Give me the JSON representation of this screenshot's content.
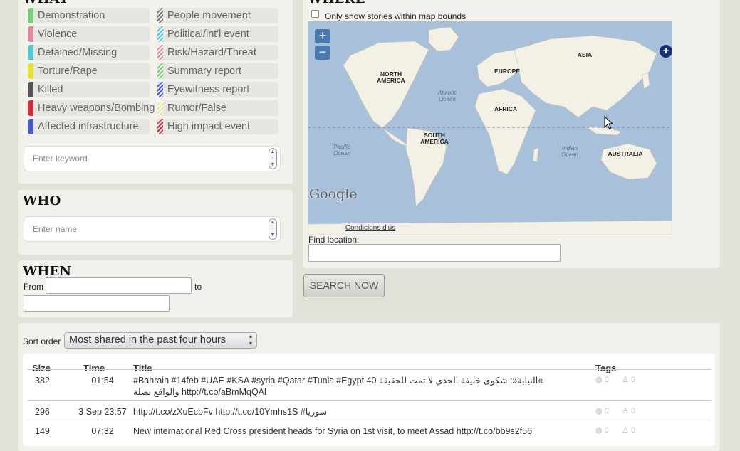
{
  "what": {
    "heading": "WHAT",
    "tags_left": [
      {
        "label": "Demonstration",
        "color": "#7bc97b"
      },
      {
        "label": "Violence",
        "color": "#d98b9c"
      },
      {
        "label": "Detained/Missing",
        "color": "#5bc3cc"
      },
      {
        "label": "Torture/Rape",
        "color": "#e6e23a"
      },
      {
        "label": "Killed",
        "color": "#555555"
      },
      {
        "label": "Heavy weapons/Bombing",
        "color": "#c8333f"
      },
      {
        "label": "Affected infrastructure",
        "color": "#4c5bc7"
      }
    ],
    "tags_right": [
      {
        "label": "People movement",
        "color": "#777777"
      },
      {
        "label": "Political/int'l event",
        "color": "#5bc3cc"
      },
      {
        "label": "Risk/Hazard/Threat",
        "color": "#d98b9c"
      },
      {
        "label": "Summary report",
        "color": "#7bc97b"
      },
      {
        "label": "Eyewitness report",
        "color": "#4c5bc7"
      },
      {
        "label": "Rumor/False",
        "color": "#e8e6a0"
      },
      {
        "label": "High impact event",
        "color": "#c8333f"
      }
    ],
    "keyword_placeholder": "Enter keyword"
  },
  "who": {
    "heading": "WHO",
    "name_placeholder": "Enter name"
  },
  "when": {
    "heading": "WHEN",
    "from_label": "From",
    "to_label": "to"
  },
  "where": {
    "heading": "WHERE",
    "bounds_checkbox_label": "Only show stories within map bounds",
    "map": {
      "continents": [
        "NORTH AMERICA",
        "EUROPE",
        "ASIA",
        "AFRICA",
        "SOUTH AMERICA",
        "AUSTRALIA"
      ],
      "oceans": [
        "Atlantic Ocean",
        "Pacific Ocean",
        "Indian Ocean"
      ],
      "attribution": "Google",
      "terms": "Condicions d'ús"
    },
    "find_location_label": "Find location:"
  },
  "search_button": "SEARCH NOW",
  "sort": {
    "label": "Sort order",
    "selected": "Most shared in the past four hours"
  },
  "table": {
    "headers": {
      "size": "Size",
      "time": "Time",
      "title": "Title",
      "tags": "Tags"
    },
    "rows": [
      {
        "size": "382",
        "time": "01:54",
        "title_line1": "#Bahrain #14feb #UAE #KSA #syria #Qatar #Tunis #Egypt 40 النيابة«: شكوى خليفة الحدي لا تمت للحقيقة«",
        "title_line2": "والواقع بصلة http://t.co/aBmMqQAl",
        "geo_count": "0",
        "person_count": "0"
      },
      {
        "size": "296",
        "time": "3 Sep 23:57",
        "title_line1": "http://t.co/zXuEcbFv http://t.co/10Ymhs1S #سوريا",
        "title_line2": "",
        "geo_count": "0",
        "person_count": "0"
      },
      {
        "size": "149",
        "time": "07:32",
        "title_line1": "New international Red Cross president heads for Syria on 1st visit, to meet Assad http://t.co/bb9s2f56",
        "title_line2": "",
        "geo_count": "0",
        "person_count": "0"
      }
    ]
  }
}
